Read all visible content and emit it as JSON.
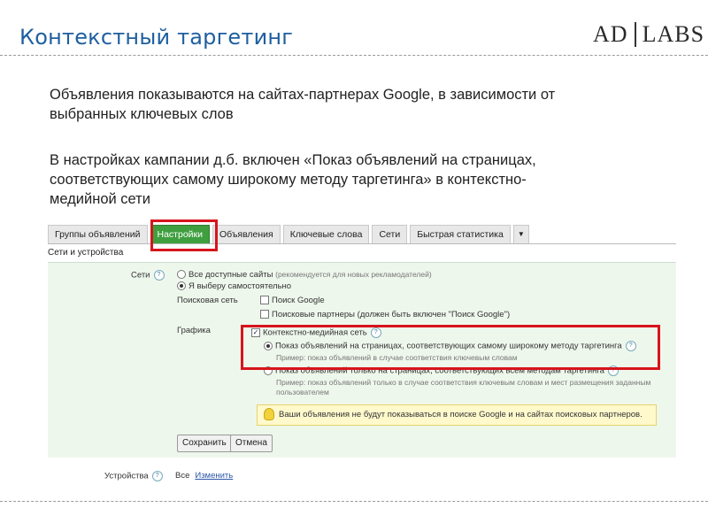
{
  "slide": {
    "title": "Контекстный таргетинг",
    "logo_left": "AD",
    "logo_right": "LABS",
    "para1_line1": "Объявления показываются на сайтах-партнерах Google, в зависимости от",
    "para1_line2": "выбранных ключевых слов",
    "para2_line1": "В настройках кампании д.б. включен «Показ объявлений на страницах,",
    "para2_line2": "соответствующих самому широкому методу таргетинга»  в контекстно-",
    "para2_line3": "медийной сети"
  },
  "tabs": [
    {
      "label": "Группы объявлений",
      "active": false
    },
    {
      "label": "Настройки",
      "active": true
    },
    {
      "label": "Объявления",
      "active": false
    },
    {
      "label": "Ключевые слова",
      "active": false
    },
    {
      "label": "Сети",
      "active": false
    },
    {
      "label": "Быстрая статистика",
      "active": false
    }
  ],
  "section": {
    "header": "Сети и устройства"
  },
  "networks": {
    "label": "Сети",
    "all_sites": "Все доступные сайты",
    "all_sites_hint": "(рекомендуется для новых рекламодателей)",
    "choose_manually": "Я выберу самостоятельно",
    "search_network_label": "Поисковая сеть",
    "google_search": "Поиск Google",
    "search_partners": "Поисковые партнеры",
    "search_partners_hint": "(должен быть включен \"Поиск Google\")",
    "display_label": "Графика",
    "display_network": "Контекстно-медийная сеть",
    "broad_option": "Показ объявлений на страницах, соответствующих самому широкому методу таргетинга",
    "broad_example": "Пример: показ объявлений в случае соответствия ключевым словам",
    "specific_option": "Показ объявлений только на страницах, соответствующих всем методам таргетинга",
    "specific_example": "Пример: показ объявлений только в случае соответствия ключевым словам и мест размещения заданным",
    "specific_example_tail": "пользователем",
    "notice": "Ваши объявления не будут показываться в поиске Google и на сайтах поисковых партнеров."
  },
  "buttons": {
    "save": "Сохранить",
    "cancel": "Отмена"
  },
  "devices": {
    "label": "Устройства",
    "value": "Все",
    "edit_link": "Изменить"
  },
  "colors": {
    "title": "#1f5fa0",
    "active_tab": "#3f9f3f",
    "highlight": "#d7141c",
    "panel": "#eef7ec"
  }
}
